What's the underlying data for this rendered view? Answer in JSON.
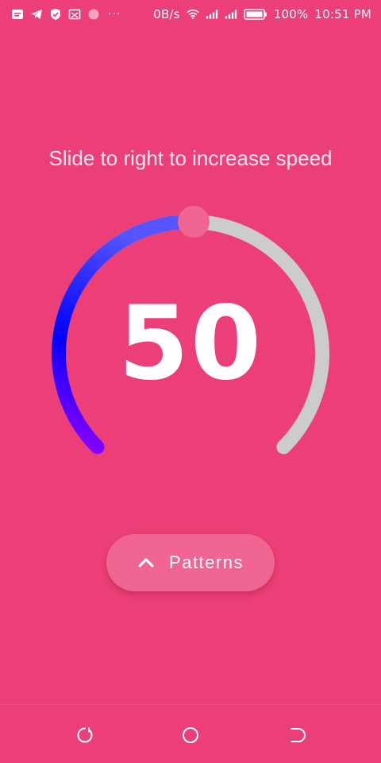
{
  "status_bar": {
    "network_speed": "0B/s",
    "battery_percent": "100%",
    "time": "10:51 PM",
    "left_icons": [
      "message-icon",
      "telegram-icon",
      "shield-icon",
      "cast-icon",
      "dot-icon"
    ],
    "overflow": "···"
  },
  "main": {
    "instruction": "Slide to right to increase speed",
    "speed": {
      "value": "50",
      "level_fraction": 0.5
    },
    "patterns_button": {
      "label": "Patterns",
      "icon": "chevron-up-icon"
    }
  },
  "colors": {
    "background": "#ec3f77",
    "track": "#cccccc",
    "gradient_start": "#9b00ff",
    "gradient_mid": "#0000ff",
    "gradient_end": "#5555ff",
    "thumb": "#f06592",
    "button": "#f06592"
  },
  "nav_bar": {
    "buttons": [
      "recent-apps",
      "home",
      "back"
    ]
  }
}
